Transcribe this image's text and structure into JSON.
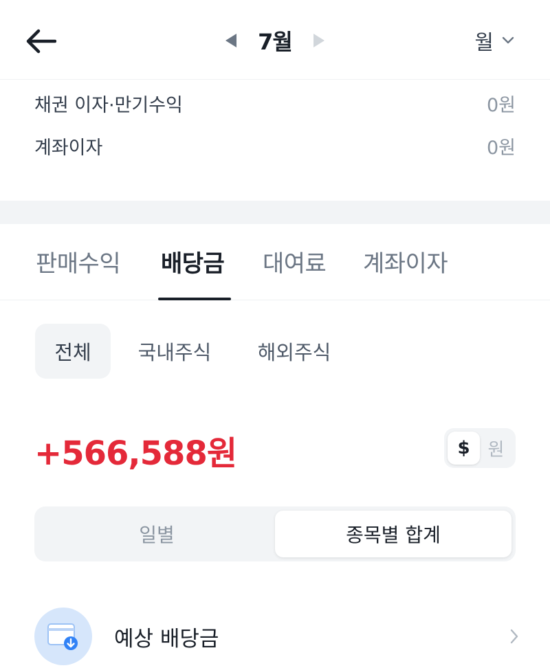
{
  "header": {
    "month": "7월",
    "period": "월"
  },
  "summary": [
    {
      "label": "채권 이자·만기수익",
      "value": "0원"
    },
    {
      "label": "계좌이자",
      "value": "0원"
    }
  ],
  "main_tabs": [
    {
      "label": "판매수익",
      "active": false
    },
    {
      "label": "배당금",
      "active": true
    },
    {
      "label": "대여료",
      "active": false
    },
    {
      "label": "계좌이자",
      "active": false
    }
  ],
  "sub_tabs": [
    {
      "label": "전체",
      "active": true
    },
    {
      "label": "국내주식",
      "active": false
    },
    {
      "label": "해외주식",
      "active": false
    }
  ],
  "total_amount": "+566,588원",
  "currency_toggle": {
    "options": [
      "$",
      "원"
    ],
    "selected": "$"
  },
  "view_segment": {
    "options": [
      "일별",
      "종목별 합계"
    ],
    "selected": "종목별 합계"
  },
  "expected_dividend": {
    "label": "예상 배당금"
  },
  "colors": {
    "amount_positive": "#e42939",
    "icon_blue": "#3182f6",
    "icon_bg": "#d6e6fb"
  }
}
